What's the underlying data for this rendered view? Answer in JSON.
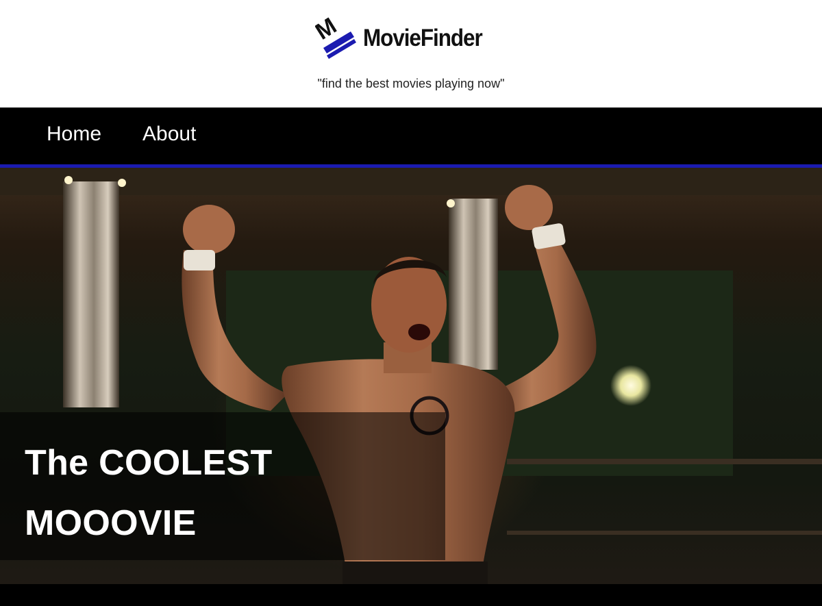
{
  "header": {
    "brand_name": "MovieFinder",
    "logo_letter": "M",
    "tagline": "\"find the best movies playing now\""
  },
  "nav": {
    "items": [
      {
        "label": "Home"
      },
      {
        "label": "About"
      }
    ]
  },
  "hero": {
    "title_line1": "The COOLEST",
    "title_line2": "MOOOVIE"
  },
  "colors": {
    "accent": "#1b1bb0",
    "nav_background": "#000000",
    "header_background": "#ffffff",
    "text_light": "#ffffff"
  },
  "icons": {
    "logo": "moviefinder-logo-icon"
  }
}
